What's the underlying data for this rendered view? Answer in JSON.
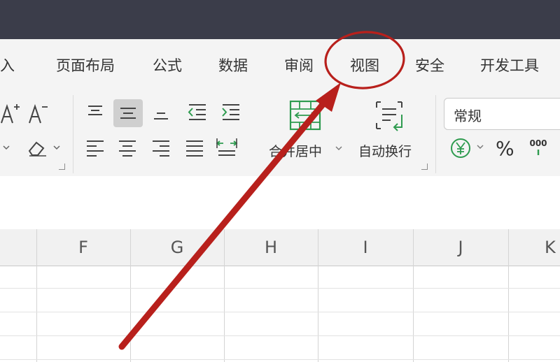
{
  "menu": {
    "items": [
      {
        "id": "insert",
        "label": "插入"
      },
      {
        "id": "page-layout",
        "label": "页面布局"
      },
      {
        "id": "formula",
        "label": "公式"
      },
      {
        "id": "data",
        "label": "数据"
      },
      {
        "id": "review",
        "label": "审阅"
      },
      {
        "id": "view",
        "label": "视图"
      },
      {
        "id": "security",
        "label": "安全"
      },
      {
        "id": "developer",
        "label": "开发工具"
      }
    ]
  },
  "ribbon": {
    "font_increase_icon": "font-size-increase-icon",
    "font_decrease_icon": "font-size-decrease-icon",
    "clear_format_icon": "eraser-icon",
    "merge_center_label": "合并居中",
    "wrap_text_label": "自动换行",
    "number_format_value": "常规",
    "currency_icon": "yen-circle-icon",
    "percent_label": "%",
    "thousands_icon": "thousands-separator-icon"
  },
  "columns": {
    "headers": [
      "F",
      "G",
      "H",
      "I",
      "J",
      "K"
    ]
  },
  "annotation": {
    "color": "#b8201c"
  },
  "colors": {
    "titlebar": "#3b3d4a",
    "ribbon_bg": "#f4f4f4",
    "active_button": "#cfcfcf",
    "accent_green": "#2e9b4f"
  }
}
